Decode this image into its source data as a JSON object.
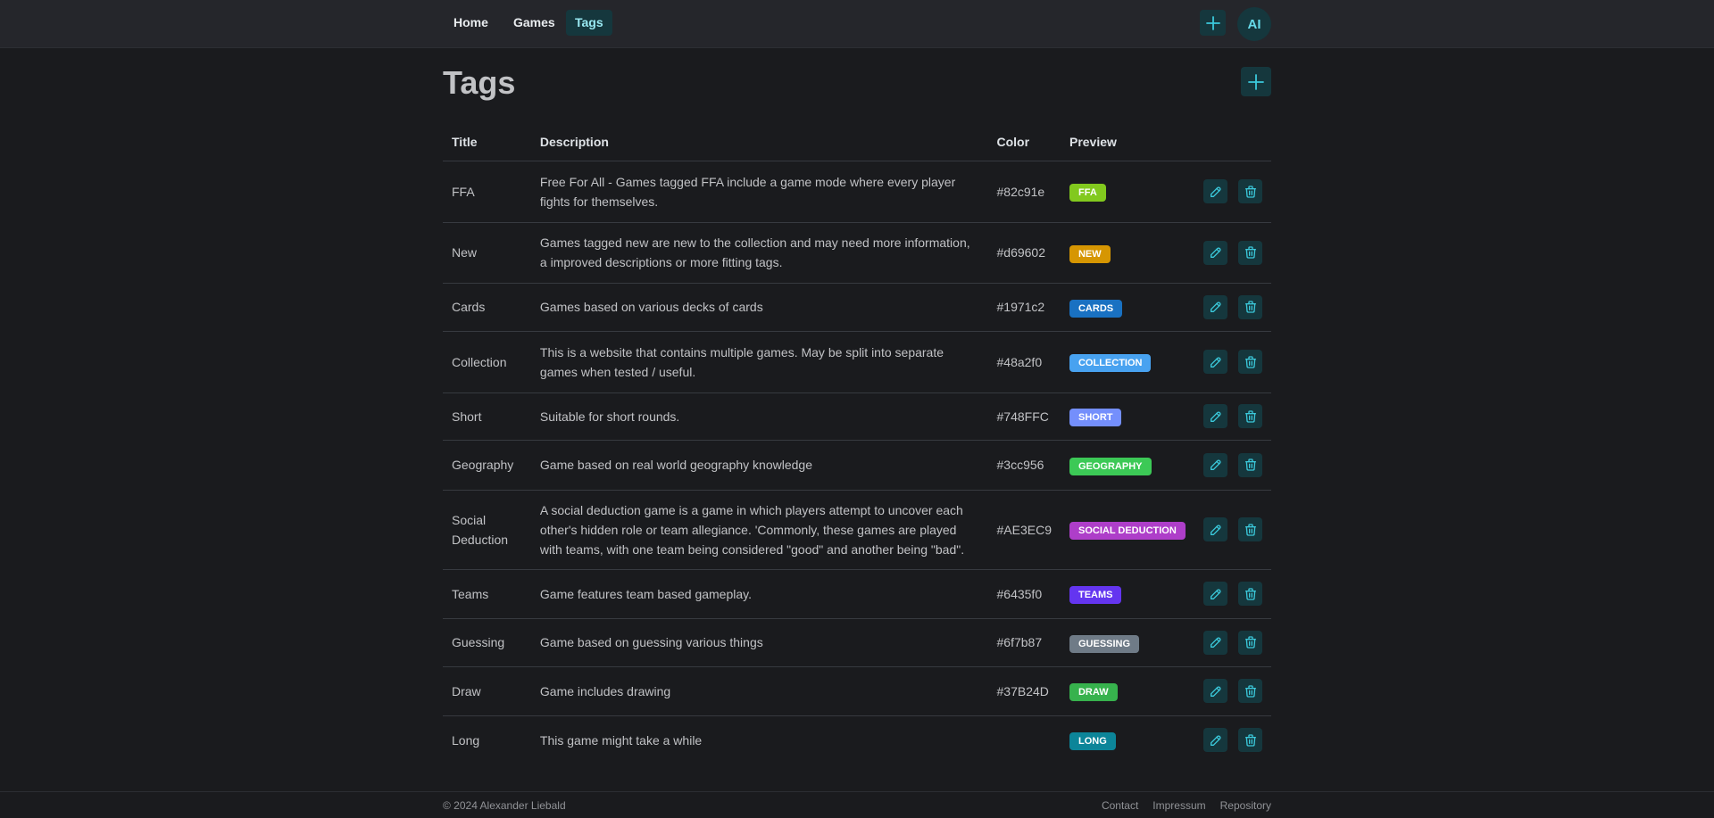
{
  "nav": {
    "links": [
      {
        "label": "Home"
      },
      {
        "label": "Games"
      },
      {
        "label": "Tags"
      }
    ],
    "avatar": "AI"
  },
  "page": {
    "title": "Tags"
  },
  "table": {
    "headers": {
      "title": "Title",
      "description": "Description",
      "color": "Color",
      "preview": "Preview"
    },
    "rows": [
      {
        "title": "FFA",
        "description": "Free For All - Games tagged FFA include a game mode where every player fights for themselves.",
        "color": "#82c91e",
        "preview": "FFA"
      },
      {
        "title": "New",
        "description": "Games tagged new are new to the collection and may need more information, a improved descriptions or more fitting tags.",
        "color": "#d69602",
        "preview": "NEW"
      },
      {
        "title": "Cards",
        "description": "Games based on various decks of cards",
        "color": "#1971c2",
        "preview": "CARDS"
      },
      {
        "title": "Collection",
        "description": "This is a website that contains multiple games. May be split into separate games when tested / useful.",
        "color": "#48a2f0",
        "preview": "COLLECTION"
      },
      {
        "title": "Short",
        "description": "Suitable for short rounds.",
        "color": "#748FFC",
        "preview": "SHORT"
      },
      {
        "title": "Geography",
        "description": "Game based on real world geography knowledge",
        "color": "#3cc956",
        "preview": "GEOGRAPHY"
      },
      {
        "title": "Social Deduction",
        "description": "A social deduction game is a game in which players attempt to uncover each other's hidden role or team allegiance. 'Commonly, these games are played with teams, with one team being considered \"good\" and another being \"bad\".",
        "color": "#AE3EC9",
        "preview": "SOCIAL DEDUCTION"
      },
      {
        "title": "Teams",
        "description": "Game features team based gameplay.",
        "color": "#6435f0",
        "preview": "TEAMS"
      },
      {
        "title": "Guessing",
        "description": "Game based on guessing various things",
        "color": "#6f7b87",
        "preview": "GUESSING"
      },
      {
        "title": "Draw",
        "description": "Game includes drawing",
        "color": "#37B24D",
        "preview": "DRAW"
      },
      {
        "title": "Long",
        "description": "This game might take a while",
        "color": "",
        "preview": "LONG",
        "badge_color": "#0c8599"
      }
    ]
  },
  "footer": {
    "copyright": "© 2024 Alexander Liebald",
    "links": [
      "Contact",
      "Impressum",
      "Repository"
    ]
  }
}
